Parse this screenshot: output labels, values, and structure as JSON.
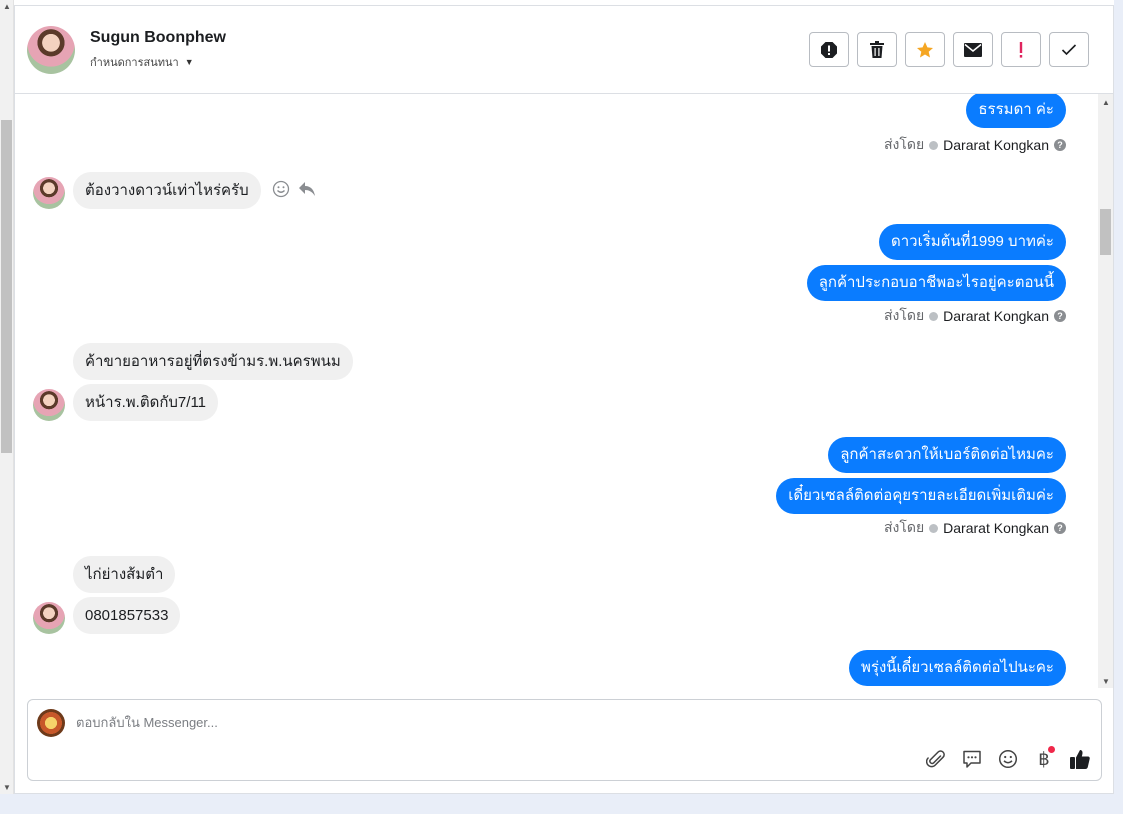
{
  "contact": {
    "name": "Sugun Boonphew",
    "assign_label": "กำหนดการสนทนา"
  },
  "header_actions": [
    {
      "icon": "alert-octagon-icon",
      "label": "spam"
    },
    {
      "icon": "trash-icon",
      "label": "delete"
    },
    {
      "icon": "star-icon",
      "label": "star",
      "color": "#f5a623"
    },
    {
      "icon": "envelope-icon",
      "label": "unread"
    },
    {
      "icon": "exclamation-icon",
      "label": "follow-up",
      "color": "#e0245e"
    },
    {
      "icon": "check-icon",
      "label": "done"
    }
  ],
  "messages": [
    {
      "dir": "out",
      "text": "ธรรมดา ค่ะ"
    },
    {
      "dir": "sent_by",
      "prefix": "ส่งโดย",
      "who": "Dararat Kongkan"
    },
    {
      "dir": "in",
      "text": "ต้องวางดาวน์เท่าไหร่ครับ"
    },
    {
      "dir": "out",
      "text": "ดาวเริ่มต้นที่1999 บาทค่ะ"
    },
    {
      "dir": "out",
      "text": "ลูกค้าประกอบอาชีพอะไรอยู่คะตอนนี้"
    },
    {
      "dir": "sent_by",
      "prefix": "ส่งโดย",
      "who": "Dararat Kongkan"
    },
    {
      "dir": "in",
      "text": "ค้าขายอาหารอยู่ที่ตรงข้ามร.พ.นครพนม"
    },
    {
      "dir": "in",
      "text": "หน้าร.พ.ติดกับ7/11"
    },
    {
      "dir": "out",
      "text": "ลูกค้าสะดวกให้เบอร์ติดต่อไหมคะ"
    },
    {
      "dir": "out",
      "text": "เดี๋ยวเซลล์ติดต่อคุยรายละเอียดเพิ่มเติมค่ะ"
    },
    {
      "dir": "sent_by",
      "prefix": "ส่งโดย",
      "who": "Dararat Kongkan"
    },
    {
      "dir": "in",
      "text": "ไก่ย่างส้มตำ"
    },
    {
      "dir": "in",
      "text": "0801857533"
    },
    {
      "dir": "out",
      "text": "พรุ่งนี้เดี๋ยวเซลล์ติดต่อไปนะคะ"
    }
  ],
  "composer": {
    "placeholder": "ตอบกลับใน Messenger...",
    "tools": [
      "paperclip-icon",
      "saved-reply-icon",
      "emoji-icon",
      "baht-icon",
      "thumbs-up-icon"
    ],
    "baht_symbol": "฿"
  },
  "colors": {
    "outgoing_bubble": "#0a7cff",
    "incoming_bubble": "#f0f0f0",
    "badge": "#f0284a"
  }
}
